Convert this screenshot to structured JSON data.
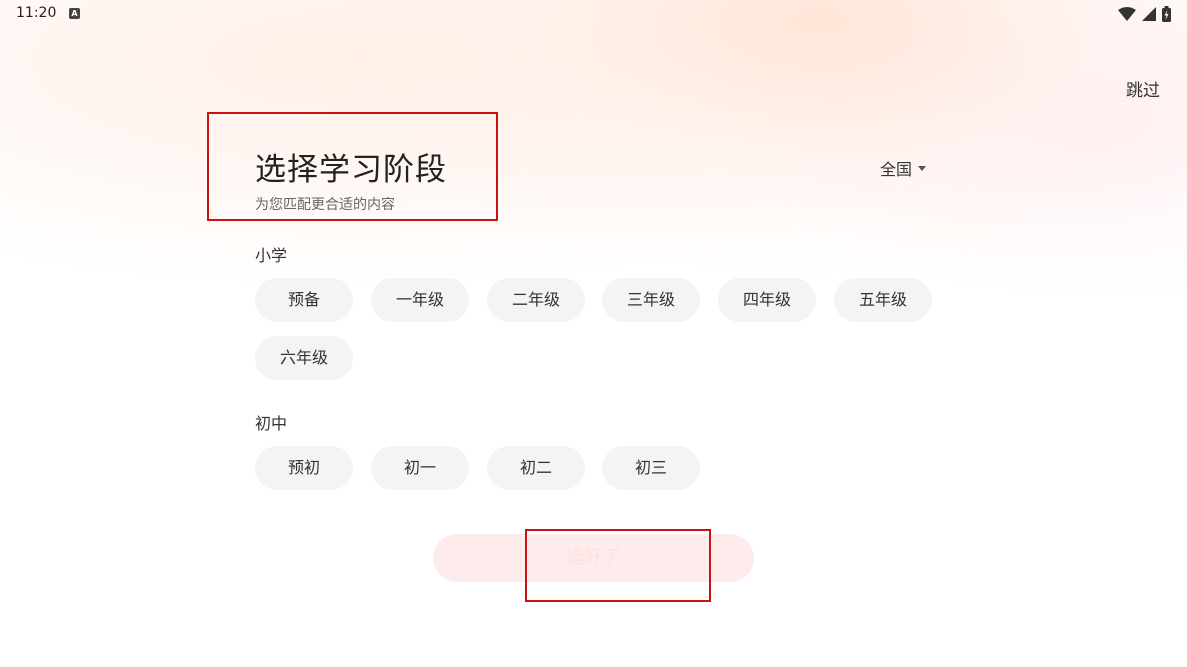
{
  "status_bar": {
    "time": "11:20",
    "notification_icon": "a-badge-icon",
    "icons": [
      "wifi-icon",
      "cellular-signal-icon",
      "battery-charging-icon"
    ]
  },
  "header": {
    "skip_label": "跳过",
    "title": "选择学习阶段",
    "subtitle": "为您匹配更合适的内容",
    "region": {
      "selected": "全国",
      "icon": "caret-down-icon"
    }
  },
  "sections": [
    {
      "title": "小学",
      "options": [
        "预备",
        "一年级",
        "二年级",
        "三年级",
        "四年级",
        "五年级",
        "六年级"
      ]
    },
    {
      "title": "初中",
      "options": [
        "预初",
        "初一",
        "初二",
        "初三"
      ]
    }
  ],
  "confirm": {
    "label": "选好了",
    "enabled": false
  },
  "colors": {
    "chip_background": "#f4f4f4",
    "confirm_disabled_background": "#fdeceb",
    "annotation_box": "#cc1111"
  }
}
